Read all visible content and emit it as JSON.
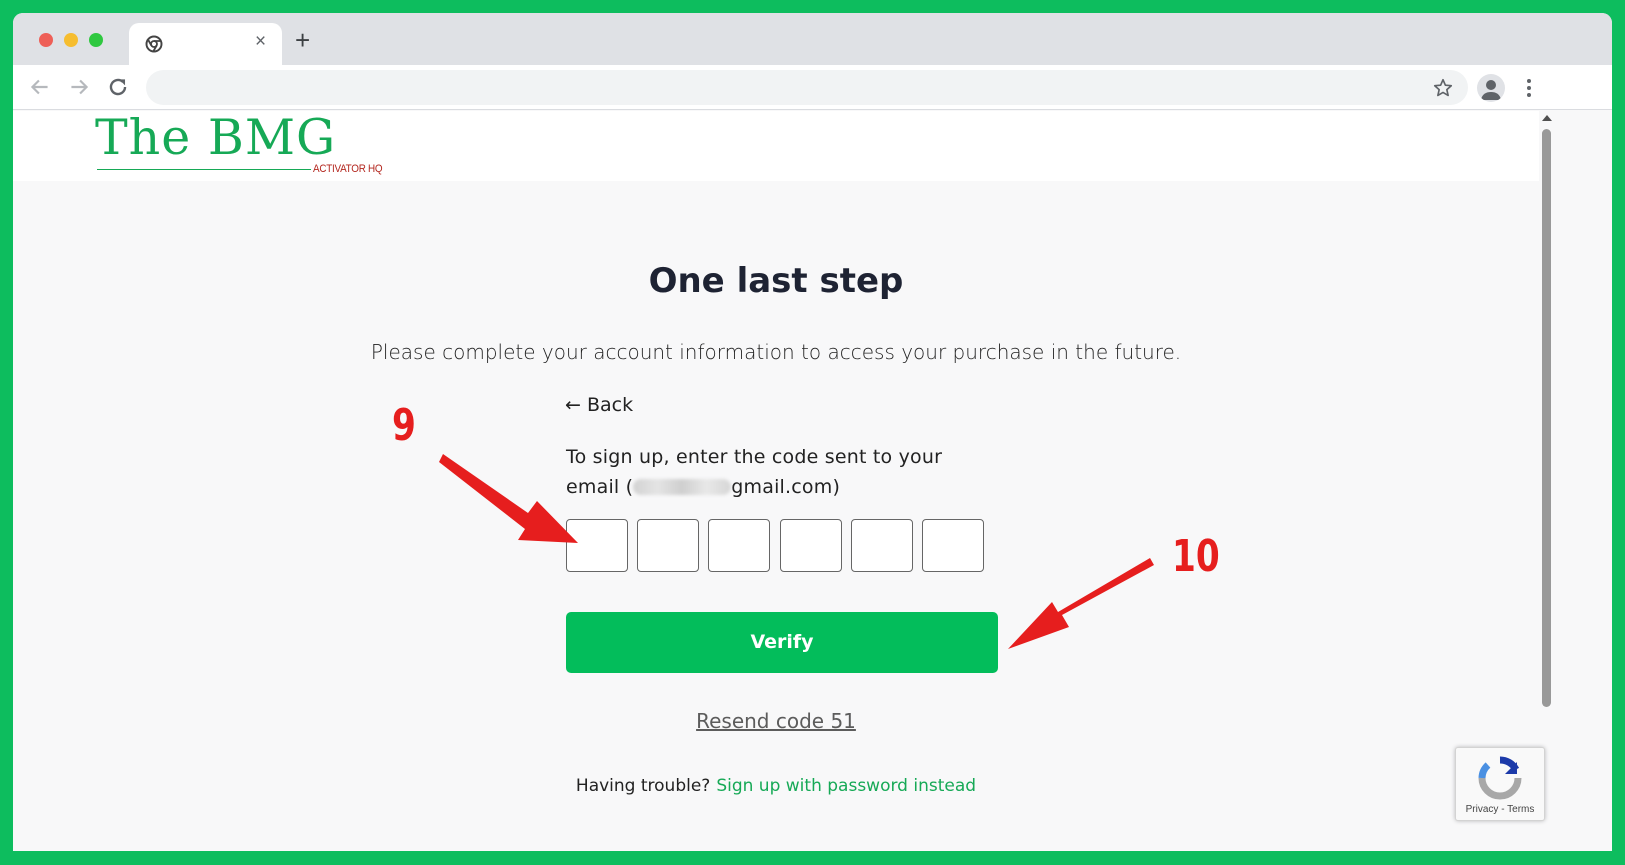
{
  "browser": {
    "tab_close": "×",
    "new_tab": "+"
  },
  "logo": {
    "title": "The BMG",
    "subtitle": "ACTIVATOR HQ"
  },
  "page": {
    "title": "One last step",
    "subtitle": "Please complete your account information to access your purchase in the future.",
    "back_label": "← Back",
    "instructions_line1": "To sign up, enter the code sent to your",
    "email_prefix": "email (",
    "email_suffix": "gmail.com)",
    "code_digits": [
      "",
      "",
      "",
      "",
      "",
      ""
    ],
    "verify_label": "Verify",
    "resend_label": "Resend code 51",
    "trouble_text": "Having trouble?",
    "trouble_link": "Sign up with password instead"
  },
  "recaptcha": {
    "links": "Privacy - Terms"
  },
  "annotations": {
    "step_a": "9",
    "step_b": "10",
    "color": "#e61e1e"
  },
  "colors": {
    "brand_green": "#03bd5b",
    "frame_green": "#0dbd5e"
  }
}
